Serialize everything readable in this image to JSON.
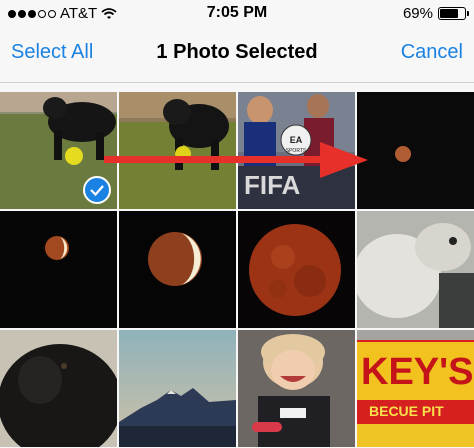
{
  "status_bar": {
    "carrier": "AT&T",
    "time": "7:05 PM",
    "battery": "69%",
    "battery_level": 0.69
  },
  "nav": {
    "select_all": "Select All",
    "title": "1 Photo Selected",
    "cancel": "Cancel"
  },
  "accent_color": "#1a82e2",
  "overlay": {
    "arrow_color": "#e8302a"
  },
  "photos": [
    {
      "subject": "dog-on-grass",
      "selected": true
    },
    {
      "subject": "dog-on-grass",
      "selected": false
    },
    {
      "subject": "fifa-game-cover",
      "selected": false
    },
    {
      "subject": "moon-night-sky",
      "selected": false
    },
    {
      "subject": "lunar-eclipse",
      "selected": false
    },
    {
      "subject": "lunar-eclipse",
      "selected": false
    },
    {
      "subject": "blood-moon",
      "selected": false
    },
    {
      "subject": "white-dog",
      "selected": false
    },
    {
      "subject": "black-dog",
      "selected": false
    },
    {
      "subject": "mountain-sunset",
      "selected": false
    },
    {
      "subject": "child-smiling",
      "selected": false
    },
    {
      "subject": "restaurant-sign",
      "selected": false
    }
  ],
  "photo_text": {
    "fifa": "FIFA",
    "ea_logo": "EA",
    "ea_sports": "SPORTS",
    "sign": "KEY'S",
    "sign_sub": "BECUE PIT"
  }
}
